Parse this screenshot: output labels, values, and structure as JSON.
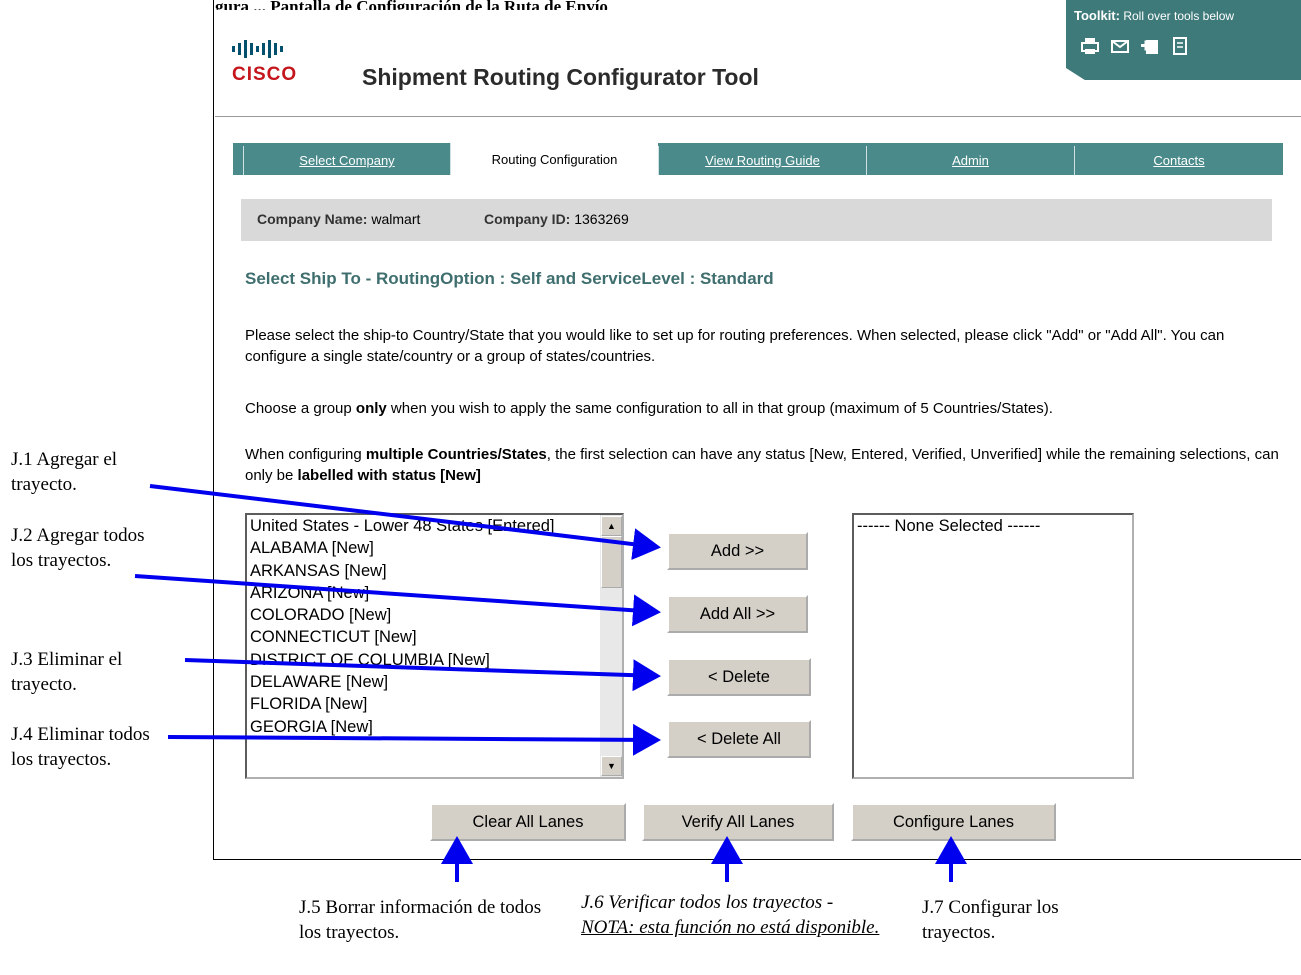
{
  "top_caption": "gura ... Pantalla de Configuración de la Ruta de Envío",
  "logo": {
    "text": "CISCO"
  },
  "app": {
    "title": "Shipment Routing Configurator Tool"
  },
  "toolkit": {
    "label_bold": "Toolkit:",
    "label_rest": " Roll over tools below",
    "icons": [
      "print-icon",
      "mail-icon",
      "add-icon",
      "document-icon"
    ]
  },
  "tabs": [
    {
      "label": "Select Company",
      "active": false
    },
    {
      "label": "Routing Configuration",
      "active": true
    },
    {
      "label": "View Routing Guide",
      "active": false
    },
    {
      "label": "Admin",
      "active": false
    },
    {
      "label": "Contacts",
      "active": false
    }
  ],
  "company": {
    "name_label": "Company Name:",
    "name_value": " walmart",
    "id_label": "Company ID:",
    "id_value": " 1363269"
  },
  "heading": "Select Ship To - RoutingOption : Self and ServiceLevel : Standard",
  "instructions": {
    "p1": "Please select the ship-to Country/State that you would like to set up for routing preferences. When selected, please click \"Add\" or \"Add All\". You can configure a single state/country or a group of states/countries.",
    "p2_a": "Choose a group ",
    "p2_b": "only",
    "p2_c": " when you wish to apply the same configuration to all in that group (maximum of 5 Countries/States).",
    "p3_a": "When configuring ",
    "p3_b": "multiple Countries/States",
    "p3_c": ", the first selection can have any status [New, Entered, Verified, Unverified] while the remaining selections, can only be ",
    "p3_d": "labelled with status [New]"
  },
  "left_list": [
    "United States - Lower 48 States [Entered]",
    "ALABAMA [New]",
    "ARKANSAS [New]",
    "ARIZONA [New]",
    "COLORADO [New]",
    "CONNECTICUT [New]",
    "DISTRICT OF COLUMBIA [New]",
    "DELAWARE [New]",
    "FLORIDA [New]",
    "GEORGIA [New]"
  ],
  "right_list": {
    "placeholder": "------ None Selected ------"
  },
  "buttons": {
    "add": "Add >>",
    "add_all": "Add All >>",
    "delete": "< Delete",
    "delete_all": "< Delete All",
    "clear_all": "Clear All Lanes",
    "verify_all": "Verify All Lanes",
    "configure": "Configure Lanes"
  },
  "annotations": {
    "j1": "J.1 Agregar el trayecto.",
    "j2": "J.2 Agregar todos los trayectos.",
    "j3": "J.3 Eliminar el trayecto.",
    "j4": "J.4 Eliminar todos los trayectos.",
    "j5": "J.5 Borrar información de todos los trayectos.",
    "j6_a": "J.6 Verificar todos los trayectos - ",
    "j6_b": "NOTA: esta función no está disponible.",
    "j7": "J.7 Configurar los trayectos."
  },
  "colors": {
    "arrow": "#0000ee",
    "tab_bar": "#4a8a8a",
    "heading": "#3f6e6e",
    "logo_red": "#c4161c"
  }
}
